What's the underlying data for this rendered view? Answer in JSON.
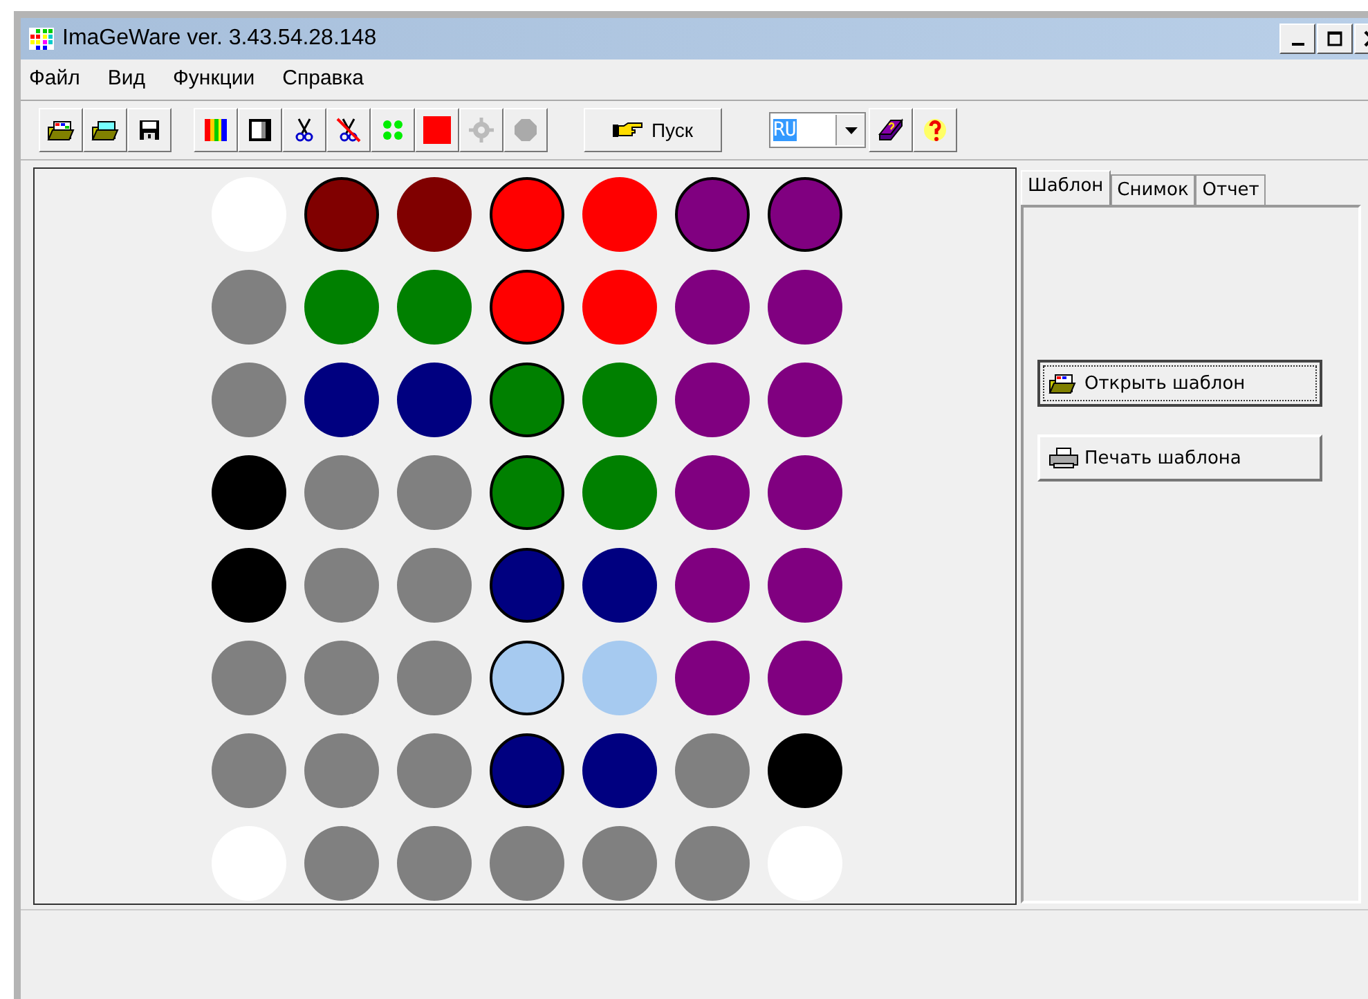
{
  "window": {
    "title": "ImaGeWare ver. 3.43.54.28.148"
  },
  "menu": [
    "Файл",
    "Вид",
    "Функции",
    "Справка"
  ],
  "toolbar": {
    "start_button": "Пуск",
    "language": {
      "value": "RU"
    }
  },
  "grid": [
    [
      {
        "color": "#ffffff",
        "outlined": false
      },
      {
        "color": "#800000",
        "outlined": true
      },
      {
        "color": "#800000",
        "outlined": false
      },
      {
        "color": "#ff0000",
        "outlined": true
      },
      {
        "color": "#ff0000",
        "outlined": false
      },
      {
        "color": "#800080",
        "outlined": true
      },
      {
        "color": "#800080",
        "outlined": true
      }
    ],
    [
      {
        "color": "#808080",
        "outlined": false
      },
      {
        "color": "#008000",
        "outlined": false
      },
      {
        "color": "#008000",
        "outlined": false
      },
      {
        "color": "#ff0000",
        "outlined": true
      },
      {
        "color": "#ff0000",
        "outlined": false
      },
      {
        "color": "#800080",
        "outlined": false
      },
      {
        "color": "#800080",
        "outlined": false
      }
    ],
    [
      {
        "color": "#808080",
        "outlined": false
      },
      {
        "color": "#000080",
        "outlined": false
      },
      {
        "color": "#000080",
        "outlined": false
      },
      {
        "color": "#008000",
        "outlined": true
      },
      {
        "color": "#008000",
        "outlined": false
      },
      {
        "color": "#800080",
        "outlined": false
      },
      {
        "color": "#800080",
        "outlined": false
      }
    ],
    [
      {
        "color": "#000000",
        "outlined": false
      },
      {
        "color": "#808080",
        "outlined": false
      },
      {
        "color": "#808080",
        "outlined": false
      },
      {
        "color": "#008000",
        "outlined": true
      },
      {
        "color": "#008000",
        "outlined": false
      },
      {
        "color": "#800080",
        "outlined": false
      },
      {
        "color": "#800080",
        "outlined": false
      }
    ],
    [
      {
        "color": "#000000",
        "outlined": false
      },
      {
        "color": "#808080",
        "outlined": false
      },
      {
        "color": "#808080",
        "outlined": false
      },
      {
        "color": "#000080",
        "outlined": true
      },
      {
        "color": "#000080",
        "outlined": false
      },
      {
        "color": "#800080",
        "outlined": false
      },
      {
        "color": "#800080",
        "outlined": false
      }
    ],
    [
      {
        "color": "#808080",
        "outlined": false
      },
      {
        "color": "#808080",
        "outlined": false
      },
      {
        "color": "#808080",
        "outlined": false
      },
      {
        "color": "#a6caf0",
        "outlined": true
      },
      {
        "color": "#a6caf0",
        "outlined": false
      },
      {
        "color": "#800080",
        "outlined": false
      },
      {
        "color": "#800080",
        "outlined": false
      }
    ],
    [
      {
        "color": "#808080",
        "outlined": false
      },
      {
        "color": "#808080",
        "outlined": false
      },
      {
        "color": "#808080",
        "outlined": false
      },
      {
        "color": "#000080",
        "outlined": true
      },
      {
        "color": "#000080",
        "outlined": false
      },
      {
        "color": "#808080",
        "outlined": false
      },
      {
        "color": "#000000",
        "outlined": false
      }
    ],
    [
      {
        "color": "#ffffff",
        "outlined": false
      },
      {
        "color": "#808080",
        "outlined": false
      },
      {
        "color": "#808080",
        "outlined": false
      },
      {
        "color": "#808080",
        "outlined": false
      },
      {
        "color": "#808080",
        "outlined": false
      },
      {
        "color": "#808080",
        "outlined": false
      },
      {
        "color": "#ffffff",
        "outlined": false
      }
    ]
  ],
  "tabs": [
    {
      "label": "Шаблон",
      "selected": true
    },
    {
      "label": "Снимок",
      "selected": false
    },
    {
      "label": "Отчет",
      "selected": false
    }
  ],
  "panel_buttons": [
    {
      "kind": "open",
      "label": "Открыть шаблон",
      "focused": true
    },
    {
      "kind": "print",
      "label": "Печать шаблона",
      "focused": false
    }
  ]
}
